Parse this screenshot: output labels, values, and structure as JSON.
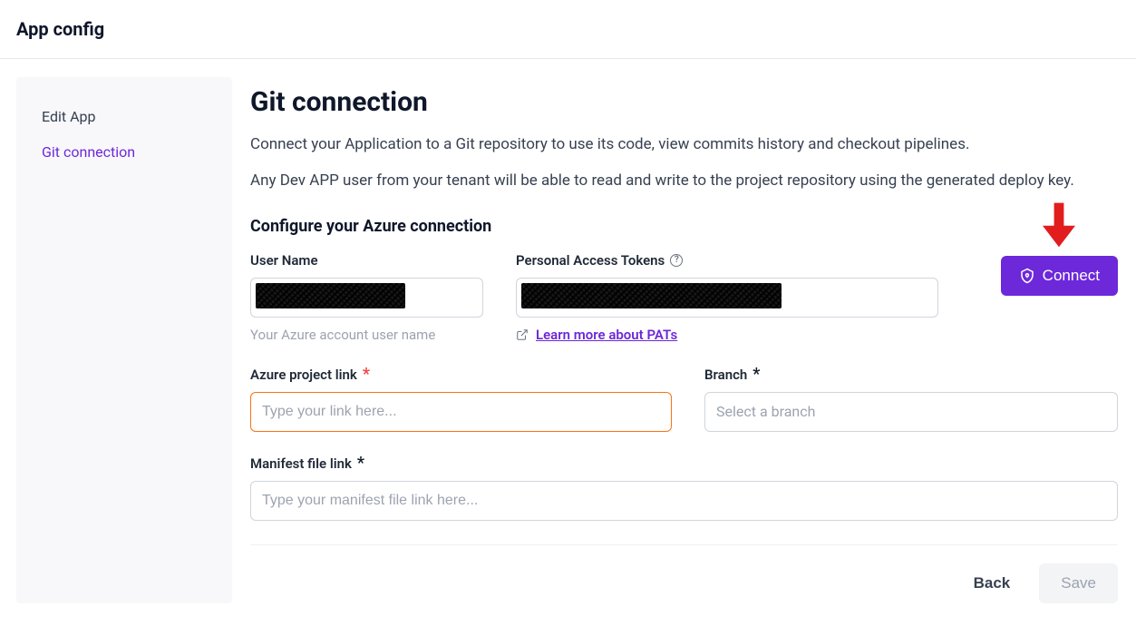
{
  "header": {
    "title": "App config"
  },
  "sidebar": {
    "items": [
      {
        "label": "Edit App",
        "active": false
      },
      {
        "label": "Git connection",
        "active": true
      }
    ]
  },
  "main": {
    "title": "Git connection",
    "desc1": "Connect your Application to a Git repository to use its code, view commits history and checkout pipelines.",
    "desc2": "Any Dev APP user from your tenant will be able to read and write to the project repository using the generated deploy key.",
    "section_title": "Configure your Azure connection",
    "fields": {
      "username_label": "User Name",
      "username_helper": "Your Azure account user name",
      "pat_label": "Personal Access Tokens",
      "pat_learn_more": "Learn more about PATs",
      "project_link_label": "Azure project link",
      "project_link_placeholder": "Type your link here...",
      "branch_label": "Branch",
      "branch_placeholder": "Select a branch",
      "manifest_label": "Manifest file link",
      "manifest_placeholder": "Type your manifest file link here..."
    },
    "connect_label": "Connect"
  },
  "footer": {
    "back": "Back",
    "save": "Save"
  }
}
